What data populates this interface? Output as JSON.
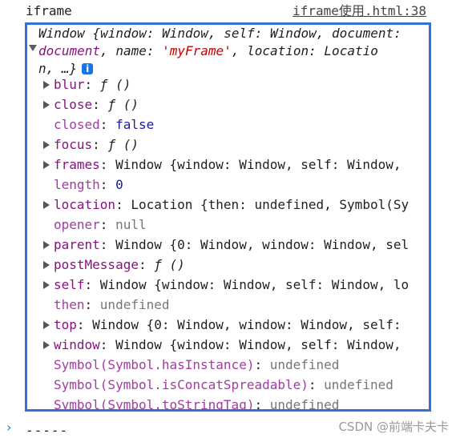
{
  "log": {
    "label": "iframe",
    "source": "iframe使用.html:38"
  },
  "summary": {
    "line1": "Window {window: Window, self: Window, document:",
    "line2_key": "document",
    "line2_sep1": ", ",
    "line2_name_key": "name",
    "line2_name_val": "'myFrame'",
    "line2_loc": ", location: Locatio",
    "line3": "n, …}",
    "info_icon": "i"
  },
  "rows": [
    {
      "key": "blur",
      "value": "ƒ ()",
      "expandable": true,
      "vtype": "obj"
    },
    {
      "key": "close",
      "value": "ƒ ()",
      "expandable": true,
      "vtype": "obj"
    },
    {
      "key": "closed",
      "value": "false",
      "expandable": false,
      "vtype": "kw"
    },
    {
      "key": "focus",
      "value": "ƒ ()",
      "expandable": true,
      "vtype": "obj"
    },
    {
      "key": "frames",
      "value": "Window {window: Window, self: Window,",
      "expandable": true,
      "vtype": "obj"
    },
    {
      "key": "length",
      "value": "0",
      "expandable": false,
      "vtype": "num"
    },
    {
      "key": "location",
      "value": "Location {then: undefined, Symbol(Sy",
      "expandable": true,
      "vtype": "obj"
    },
    {
      "key": "opener",
      "value": "null",
      "expandable": false,
      "vtype": "und"
    },
    {
      "key": "parent",
      "value": "Window {0: Window, window: Window, sel",
      "expandable": true,
      "vtype": "obj"
    },
    {
      "key": "postMessage",
      "value": "ƒ ()",
      "expandable": true,
      "vtype": "obj"
    },
    {
      "key": "self",
      "value": "Window {window: Window, self: Window, lo",
      "expandable": true,
      "vtype": "obj"
    },
    {
      "key": "then",
      "value": "undefined",
      "expandable": false,
      "vtype": "und"
    },
    {
      "key": "top",
      "value": "Window {0: Window, window: Window, self:",
      "expandable": true,
      "vtype": "obj"
    },
    {
      "key": "window",
      "value": "Window {window: Window, self: Window,",
      "expandable": true,
      "vtype": "obj"
    },
    {
      "key": "Symbol(Symbol.hasInstance)",
      "value": "undefined",
      "expandable": false,
      "vtype": "und"
    },
    {
      "key": "Symbol(Symbol.isConcatSpreadable)",
      "value": "undefined",
      "expandable": false,
      "vtype": "und"
    },
    {
      "key": "Symbol(Symbol.toStringTag)",
      "value": "undefined",
      "expandable": false,
      "vtype": "und"
    }
  ],
  "console": {
    "prompt": "›",
    "next_output": "-----"
  },
  "watermark": "CSDN @前端卡夫卡",
  "colors": {
    "key": "#881280",
    "highlight_border": "#2f72d8",
    "string": "#c80000",
    "number": "#1a1aa6"
  }
}
